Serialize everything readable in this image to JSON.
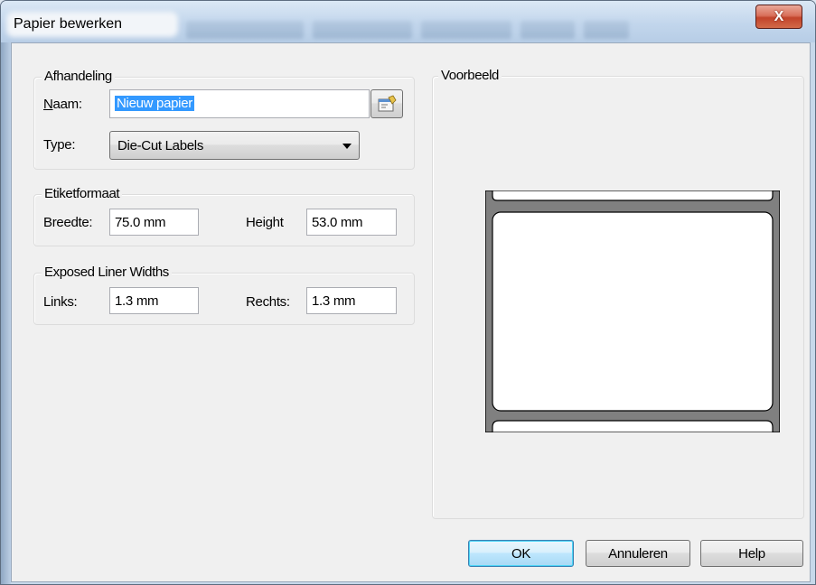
{
  "window": {
    "title": "Papier bewerken",
    "close_label": "X"
  },
  "handling": {
    "group_label": "Afhandeling",
    "name_label": "Naam:",
    "name_value": "Nieuw papier",
    "type_label": "Type:",
    "type_value": "Die-Cut Labels"
  },
  "label_format": {
    "group_label": "Etiketformaat",
    "width_label": "Breedte:",
    "width_value": "75.0 mm",
    "height_label": "Height",
    "height_value": "53.0 mm"
  },
  "liner": {
    "group_label": "Exposed Liner Widths",
    "left_label": "Links:",
    "left_value": "1.3 mm",
    "right_label": "Rechts:",
    "right_value": "1.3 mm"
  },
  "preview": {
    "group_label": "Voorbeeld"
  },
  "buttons": {
    "ok": "OK",
    "cancel": "Annuleren",
    "help": "Help"
  },
  "icons": {
    "properties": "properties-icon",
    "dropdown": "chevron-down-icon",
    "close": "close-icon"
  },
  "colors": {
    "selection": "#3399ff",
    "close_button": "#c2432b",
    "label_stock": "#808080"
  }
}
